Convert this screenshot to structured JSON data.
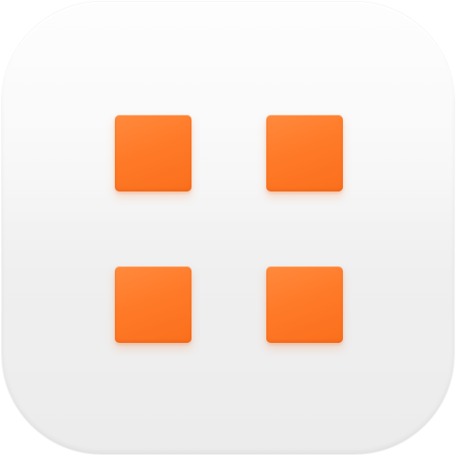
{
  "app_icon": {
    "name": "grid-app-icon",
    "icon_semantic": "four-square-grid-icon",
    "colors": {
      "background": "#f4f4f4",
      "tile": "#ff7a28"
    },
    "tiles": [
      "top-left",
      "top-right",
      "bottom-left",
      "bottom-right"
    ]
  }
}
